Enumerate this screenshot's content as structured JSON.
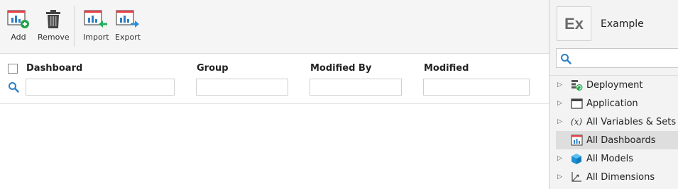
{
  "toolbar": {
    "buttons": [
      {
        "label": "Add",
        "icon": "add-dashboard-icon"
      },
      {
        "label": "Remove",
        "icon": "trash-icon"
      },
      {
        "label": "Import",
        "icon": "import-icon"
      },
      {
        "label": "Export",
        "icon": "export-icon"
      }
    ]
  },
  "grid": {
    "columns": [
      {
        "label": "Dashboard"
      },
      {
        "label": "Group"
      },
      {
        "label": "Modified By"
      },
      {
        "label": "Modified"
      }
    ]
  },
  "panel": {
    "tile_text": "Ex",
    "workspace_name": "Example",
    "search": {
      "placeholder": "",
      "value": ""
    },
    "tree": [
      {
        "label": "Deployment",
        "icon": "deployment-icon",
        "expandable": true,
        "selected": false
      },
      {
        "label": "Application",
        "icon": "window-icon",
        "expandable": true,
        "selected": false
      },
      {
        "label": "All Variables & Sets",
        "icon": "variable-icon",
        "expandable": true,
        "selected": false
      },
      {
        "label": "All Dashboards",
        "icon": "dashboard-icon",
        "expandable": false,
        "selected": true
      },
      {
        "label": "All Models",
        "icon": "cube-icon",
        "expandable": true,
        "selected": false
      },
      {
        "label": "All Dimensions",
        "icon": "axes-icon",
        "expandable": true,
        "selected": false
      }
    ]
  },
  "colors": {
    "accent_red": "#e8434a",
    "accent_blue": "#2f7fc4",
    "add_green": "#22a447",
    "import_green": "#27ae60",
    "export_blue": "#2d8fd6",
    "selected_row": "#dedede"
  }
}
